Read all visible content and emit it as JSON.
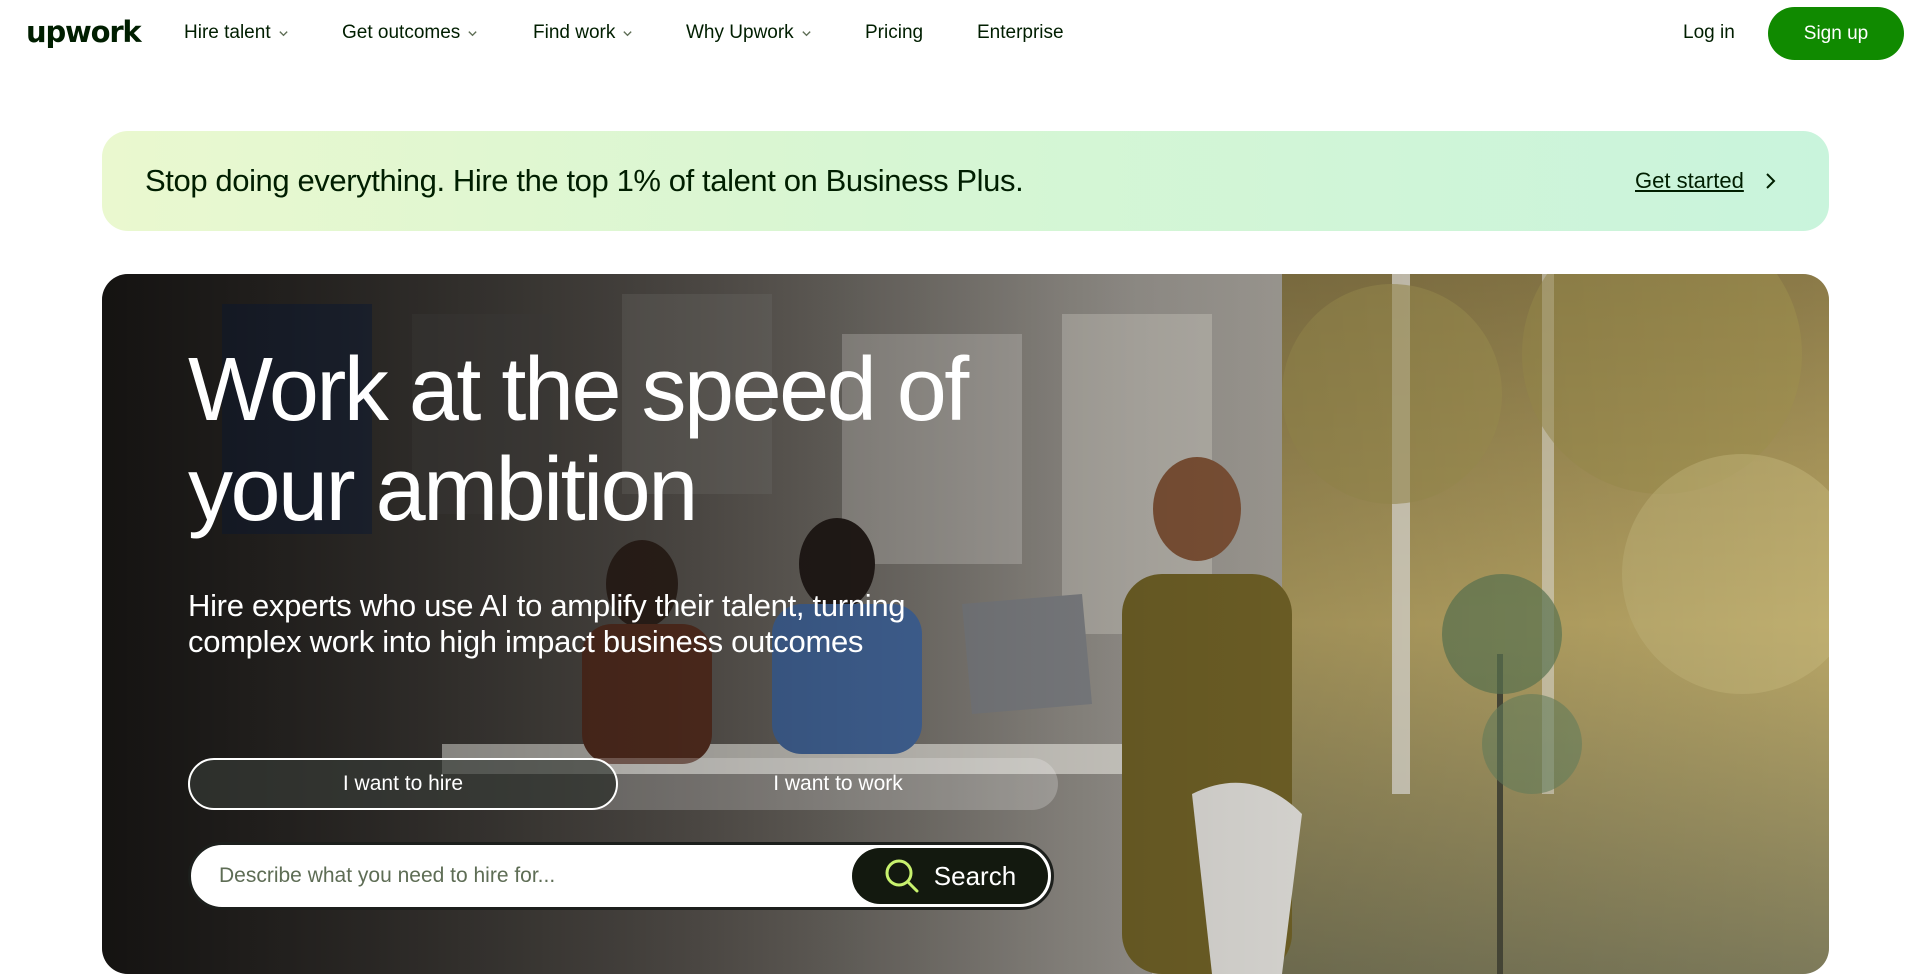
{
  "header": {
    "logo": "upwork",
    "nav": [
      {
        "label": "Hire talent",
        "has_menu": true
      },
      {
        "label": "Get outcomes",
        "has_menu": true
      },
      {
        "label": "Find work",
        "has_menu": true
      },
      {
        "label": "Why Upwork",
        "has_menu": true
      },
      {
        "label": "Pricing",
        "has_menu": false
      },
      {
        "label": "Enterprise",
        "has_menu": false
      }
    ],
    "login_label": "Log in",
    "signup_label": "Sign up"
  },
  "promo": {
    "text": "Stop doing everything. Hire the top 1% of talent on Business Plus.",
    "link_label": "Get started"
  },
  "hero": {
    "title_line1": "Work at the speed of",
    "title_line2": "your ambition",
    "subtitle_line1": "Hire experts who use AI to amplify their talent, turning",
    "subtitle_line2": "complex work into high impact business outcomes",
    "toggle": {
      "hire_label": "I want to hire",
      "work_label": "I want to work",
      "selected": "hire"
    },
    "search": {
      "placeholder": "Describe what you need to hire for...",
      "value": "",
      "button_label": "Search"
    }
  },
  "colors": {
    "brand_green": "#108a00",
    "text_dark": "#001e00",
    "promo_gradient_start": "#eaf8cf",
    "promo_gradient_end": "#c9f4dc",
    "search_accent": "#c8f26e"
  },
  "icons": {
    "nav_chevron": "chevron-down-icon",
    "promo_arrow": "chevron-right-icon",
    "search": "search-icon"
  }
}
